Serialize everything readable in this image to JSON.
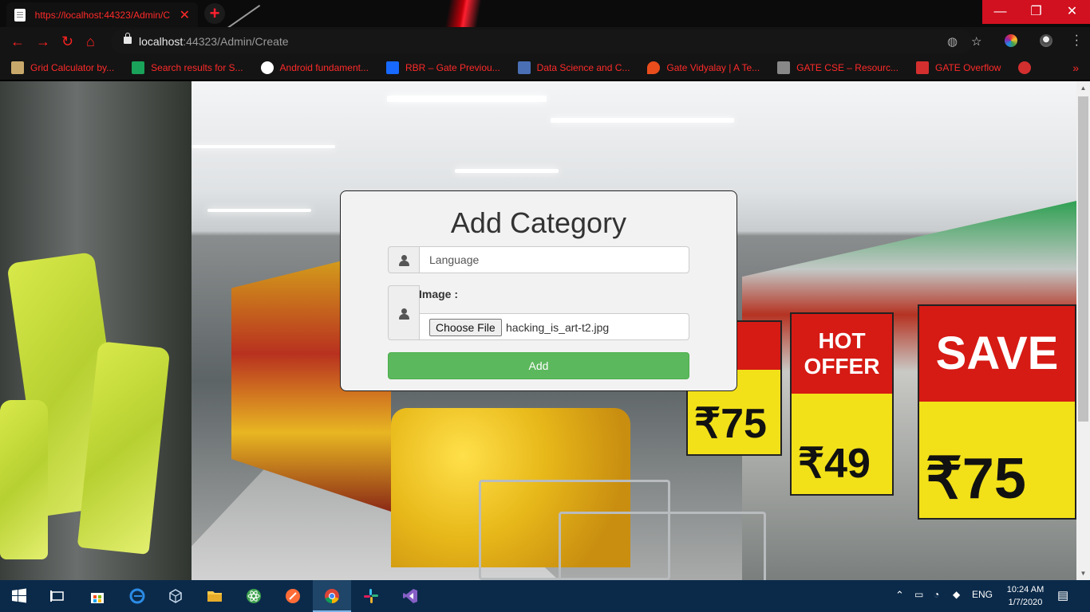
{
  "browser": {
    "tab_title": "https://localhost:44323/Admin/C",
    "tab_close": "✕",
    "new_tab": "+",
    "url_host": "localhost",
    "url_rest": ":44323/Admin/Create",
    "window_controls": [
      "—",
      "❐",
      "✕"
    ],
    "nav": {
      "back": "←",
      "forward": "→",
      "reload": "↻",
      "home": "⌂"
    },
    "bookmarks": [
      {
        "label": "Grid Calculator by...",
        "color": "#c9a96b"
      },
      {
        "label": "Search results for S...",
        "color": "#1aa35a"
      },
      {
        "label": "Android fundament...",
        "color": "#ffffff"
      },
      {
        "label": "RBR – Gate Previou...",
        "color": "#1769ff"
      },
      {
        "label": "Data Science and C...",
        "color": "#4a6fb5"
      },
      {
        "label": "Gate Vidyalay | A Te...",
        "color": "#e94d1c"
      },
      {
        "label": "GATE CSE – Resourc...",
        "color": "#888888"
      },
      {
        "label": "GATE Overflow",
        "color": "#d32f2f"
      }
    ],
    "bookmarks_more": "»"
  },
  "form": {
    "title": "Add Category",
    "category_placeholder": "Language",
    "image_label": "Image :",
    "choose_file_label": "Choose File",
    "file_name": "hacking_is_art-t2.jpg",
    "submit_label": "Add"
  },
  "background_signs": {
    "sign1": {
      "banner": "HOT OFFER",
      "price": "₹49"
    },
    "sign2": {
      "banner": "SAVE",
      "price": "₹75"
    },
    "sign3": {
      "price": "₹75"
    }
  },
  "taskbar": {
    "lang": "ENG",
    "time": "10:24 AM",
    "date": "1/7/2020"
  },
  "colors": {
    "accent_red": "#ff2a2a",
    "submit_green": "#5cb85c",
    "taskbar": "#0b2a4a"
  }
}
